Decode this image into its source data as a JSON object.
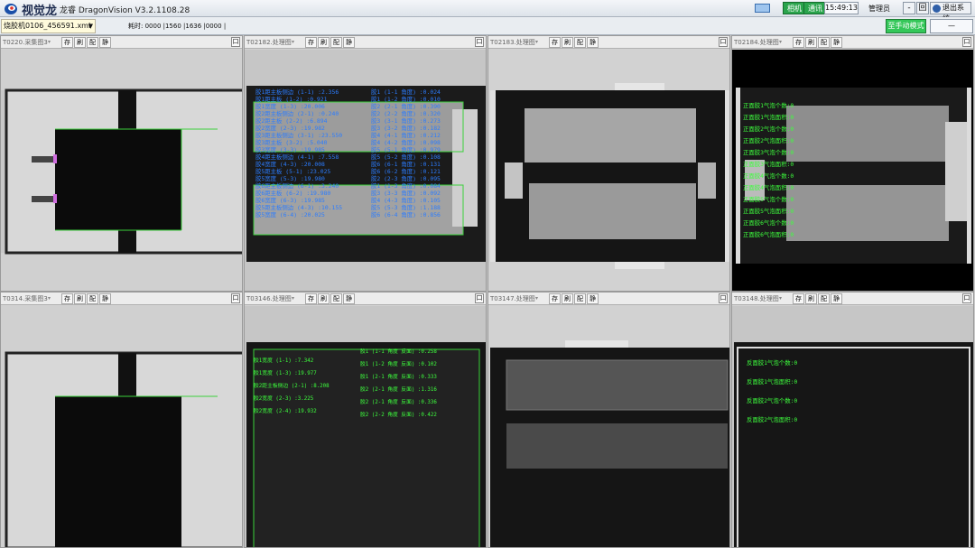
{
  "titlebar": {
    "brand": "视觉龙",
    "app_title": "龙睿 DragonVision V3.2.1108.28",
    "lamp_1": "相机",
    "lamp_2": "通讯",
    "clock": "15:49:13",
    "user": "管理员",
    "minimize": "-",
    "restore": "回",
    "exit": "退出系统"
  },
  "toolbar": {
    "model": "烧胶机0106_456591.xml",
    "timing": "耗时: 0000 |1560 |1636 |0000 |",
    "mode_button": "至手动模式",
    "mode_select": "—"
  },
  "panel_buttons": [
    "存",
    "刷",
    "配",
    "静"
  ],
  "panel_max": "口",
  "panels": [
    {
      "title": "T0220.采集图3"
    },
    {
      "title": "T02182.处理图"
    },
    {
      "title": "T02183.处理图"
    },
    {
      "title": "T02184.处理图"
    },
    {
      "title": "T0314.采集图3"
    },
    {
      "title": "T03146.处理图"
    },
    {
      "title": "T03147.处理图"
    },
    {
      "title": "T03148.处理图"
    }
  ],
  "panel2_left": [
    "胶1距主板侧边 (1-1) :2.356",
    "胶1距主板 (1-2) :0.921",
    "胶1宽度 (1-3) :20.006",
    "胶2距主板侧边 (2-1) :0.240",
    "胶2距主板 (2-2) :6.894",
    "胶2宽度 (2-3) :19.982",
    "胶3距主板侧边 (3-1) :23.550",
    "胶3距主板 (3-2) :5.040",
    "胶3宽度 (3-3) :19.985",
    "胶4距主板侧边 (4-1) :7.558",
    "胶4宽度 (4-3) :20.008",
    "胶5距主板 (5-1) :23.025",
    "胶5宽度 (5-3) :19.980",
    "胶6距主板侧边 (6-1) :3.240",
    "胶6距主板 (6-2) :19.980",
    "胶6宽度 (6-3) :19.985",
    "胶5距主板侧边 (4-3) :10.155",
    "胶5宽度 (6-4) :20.025"
  ],
  "panel2_right": [
    "胶1 (1-1 角度) :0.024",
    "胶1 (1-2 角度) :0.010",
    "胶2 (2-1 角度) :0.390",
    "胶2 (2-2 角度) :0.320",
    "胶3 (3-1 角度) :0.273",
    "胶3 (3-2 角度) :0.182",
    "胶4 (4-1 角度) :0.212",
    "胶4 (4-2 角度) :0.098",
    "胶5 (5-1 角度) :0.979",
    "胶5 (5-2 角度) :0.108",
    "胶6 (6-1 角度) :0.131",
    "胶6 (6-2 角度) :0.121",
    "胶2 (2-3 角度) :0.095",
    "胶1 (1-3 角度) :0.084",
    "胶3 (3-3 角度) :0.092",
    "胶4 (4-3 角度) :0.105",
    "胶5 (5-3 角度) :1.188",
    "胶6 (6-4 角度) :0.856"
  ],
  "panel4_lines": [
    "正面胶1气泡个数:0",
    "正面胶1气泡面积:0",
    "正面胶2气泡个数:0",
    "正面胶2气泡面积:0",
    "正面胶3气泡个数:0",
    "正面胶3气泡面积:0",
    "正面胶4气泡个数:0",
    "正面胶4气泡面积:0",
    "正面胶5气泡个数:0",
    "正面胶5气泡面积:0",
    "正面胶6气泡个数:0",
    "正面胶6气泡面积:0"
  ],
  "panel6_left": [
    "胶1宽度 (1-1) :7.342",
    "胶1宽度 (1-3) :19.977",
    "胶2距主板侧边 (2-1) :8.208",
    "胶2宽度 (2-3) :3.225",
    "胶2宽度 (2-4) :19.932"
  ],
  "panel6_right": [
    "胶1 (1-1 角度 反面) :0.258",
    "胶1 (1-2 角度 反面) :0.102",
    "胶1 (2-1 角度 反面) :0.333",
    "胶2 (2-1 角度 反面) :1.316",
    "胶2 (2-1 角度 反面) :0.336",
    "胶2 (2-2 角度 反面) :0.422"
  ],
  "panel8_lines": [
    "反面胶1气泡个数:0",
    "反面胶1气泡面积:0",
    "反面胶2气泡个数:0",
    "反面胶2气泡面积:0"
  ]
}
